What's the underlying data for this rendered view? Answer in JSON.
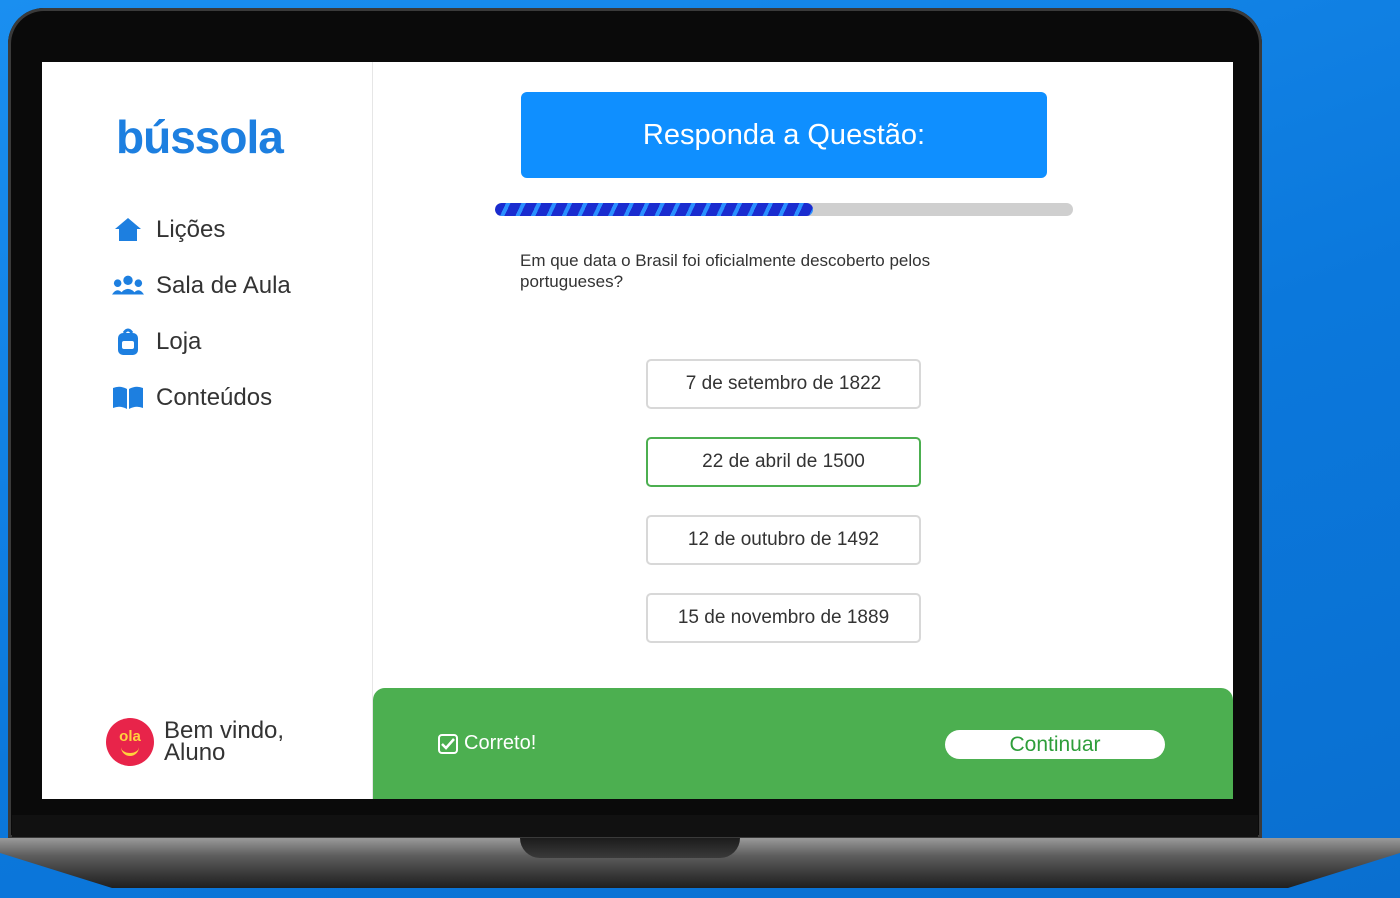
{
  "app": {
    "logo": "bússola"
  },
  "sidebar": {
    "items": [
      {
        "label": "Lições",
        "icon": "home-icon"
      },
      {
        "label": "Sala de Aula",
        "icon": "users-icon"
      },
      {
        "label": "Loja",
        "icon": "backpack-icon"
      },
      {
        "label": "Conteúdos",
        "icon": "book-icon"
      }
    ],
    "user": {
      "greeting": "Bem vindo,",
      "name": "Aluno",
      "avatar_text": "ola"
    }
  },
  "quiz": {
    "banner": "Responda a Questão:",
    "progress": 0.55,
    "question": "Em que data o Brasil foi oficialmente descoberto pelos portugueses?",
    "options": [
      "7 de setembro de 1822",
      "22 de abril de 1500",
      "12 de outubro de 1492",
      "15 de novembro de 1889"
    ],
    "selected_index": 1,
    "feedback": {
      "status": "Correto!",
      "continue_label": "Continuar"
    }
  },
  "colors": {
    "brand": "#1d7fe0",
    "banner": "#0f8fff",
    "correct": "#4caf50",
    "background": "#0b78dc"
  }
}
